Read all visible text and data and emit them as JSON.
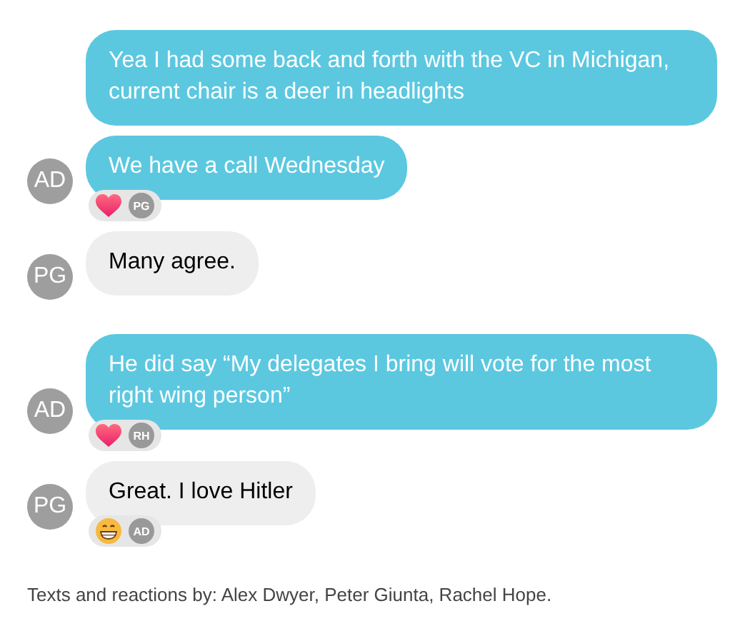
{
  "messages": [
    {
      "kind": "outgoing",
      "text": "Yea I had some back and forth with the VC in Michigan, current chair is a deer in headlights"
    },
    {
      "kind": "outgoing",
      "avatar": "AD",
      "text": "We have a call Wednesday",
      "reactions": [
        {
          "kind": "heart",
          "by": "PG"
        }
      ]
    },
    {
      "kind": "incoming",
      "avatar": "PG",
      "text": "Many agree."
    },
    {
      "kind": "outgoing",
      "avatar": "AD",
      "text": "He did say “My delegates I bring will vote for the most right wing person”",
      "reactions": [
        {
          "kind": "heart",
          "by": "RH"
        }
      ]
    },
    {
      "kind": "incoming",
      "avatar": "PG",
      "text": "Great. I love Hitler",
      "reactions": [
        {
          "kind": "grin",
          "by": "AD"
        }
      ]
    }
  ],
  "footer": "Texts and reactions by: Alex Dwyer, Peter Giunta, Rachel Hope."
}
